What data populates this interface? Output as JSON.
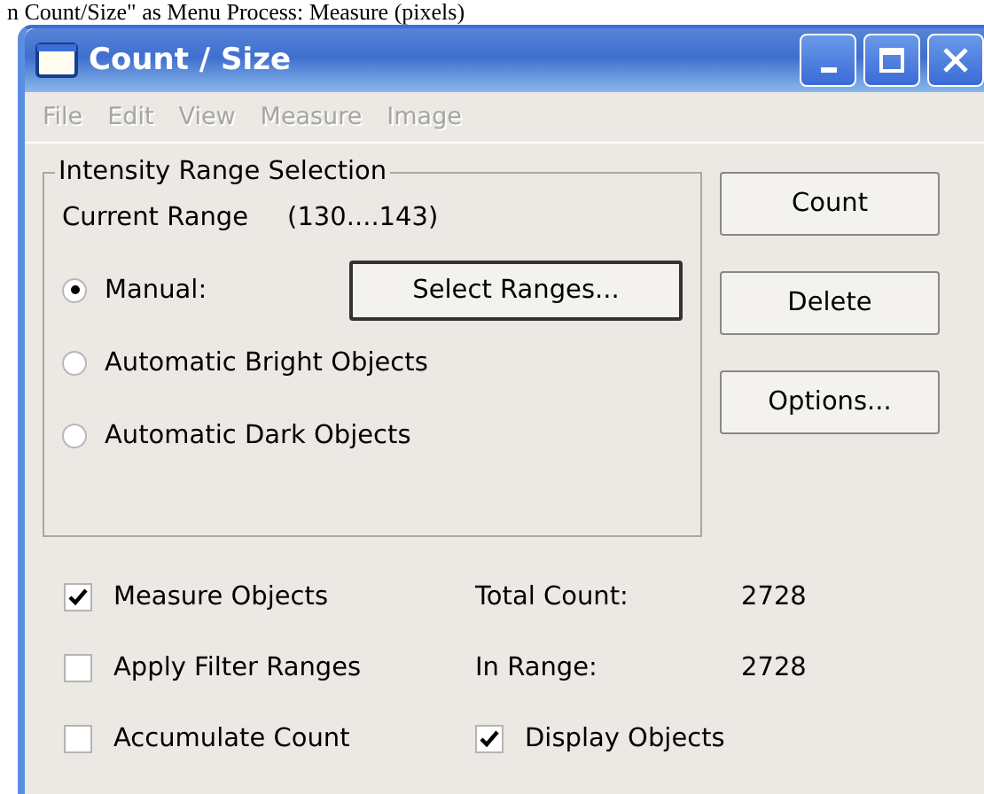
{
  "caption": "n Count/Size\" as Menu Process: Measure (pixels)",
  "window": {
    "title": "Count / Size"
  },
  "menu": [
    {
      "label": "File",
      "disabled": true
    },
    {
      "label": "Edit",
      "disabled": true
    },
    {
      "label": "View",
      "disabled": true
    },
    {
      "label": "Measure",
      "disabled": true
    },
    {
      "label": "Image",
      "disabled": true
    }
  ],
  "range_group": {
    "title": "Intensity Range Selection",
    "current_label": "Current Range",
    "current_value": "(130....143)",
    "select_button": "Select Ranges...",
    "options": [
      {
        "label": "Manual:",
        "selected": true
      },
      {
        "label": "Automatic Bright Objects",
        "selected": false
      },
      {
        "label": "Automatic Dark Objects",
        "selected": false
      }
    ]
  },
  "buttons": [
    "Count",
    "Delete",
    "Options..."
  ],
  "checkboxes": [
    {
      "label": "Measure Objects",
      "checked": true
    },
    {
      "label": "Apply Filter Ranges",
      "checked": false
    },
    {
      "label": "Accumulate Count",
      "checked": false
    }
  ],
  "stats": [
    {
      "label": "Total Count:",
      "value": "2728"
    },
    {
      "label": "In Range:",
      "value": "2728"
    }
  ],
  "display_objects": {
    "label": "Display Objects",
    "checked": true
  }
}
